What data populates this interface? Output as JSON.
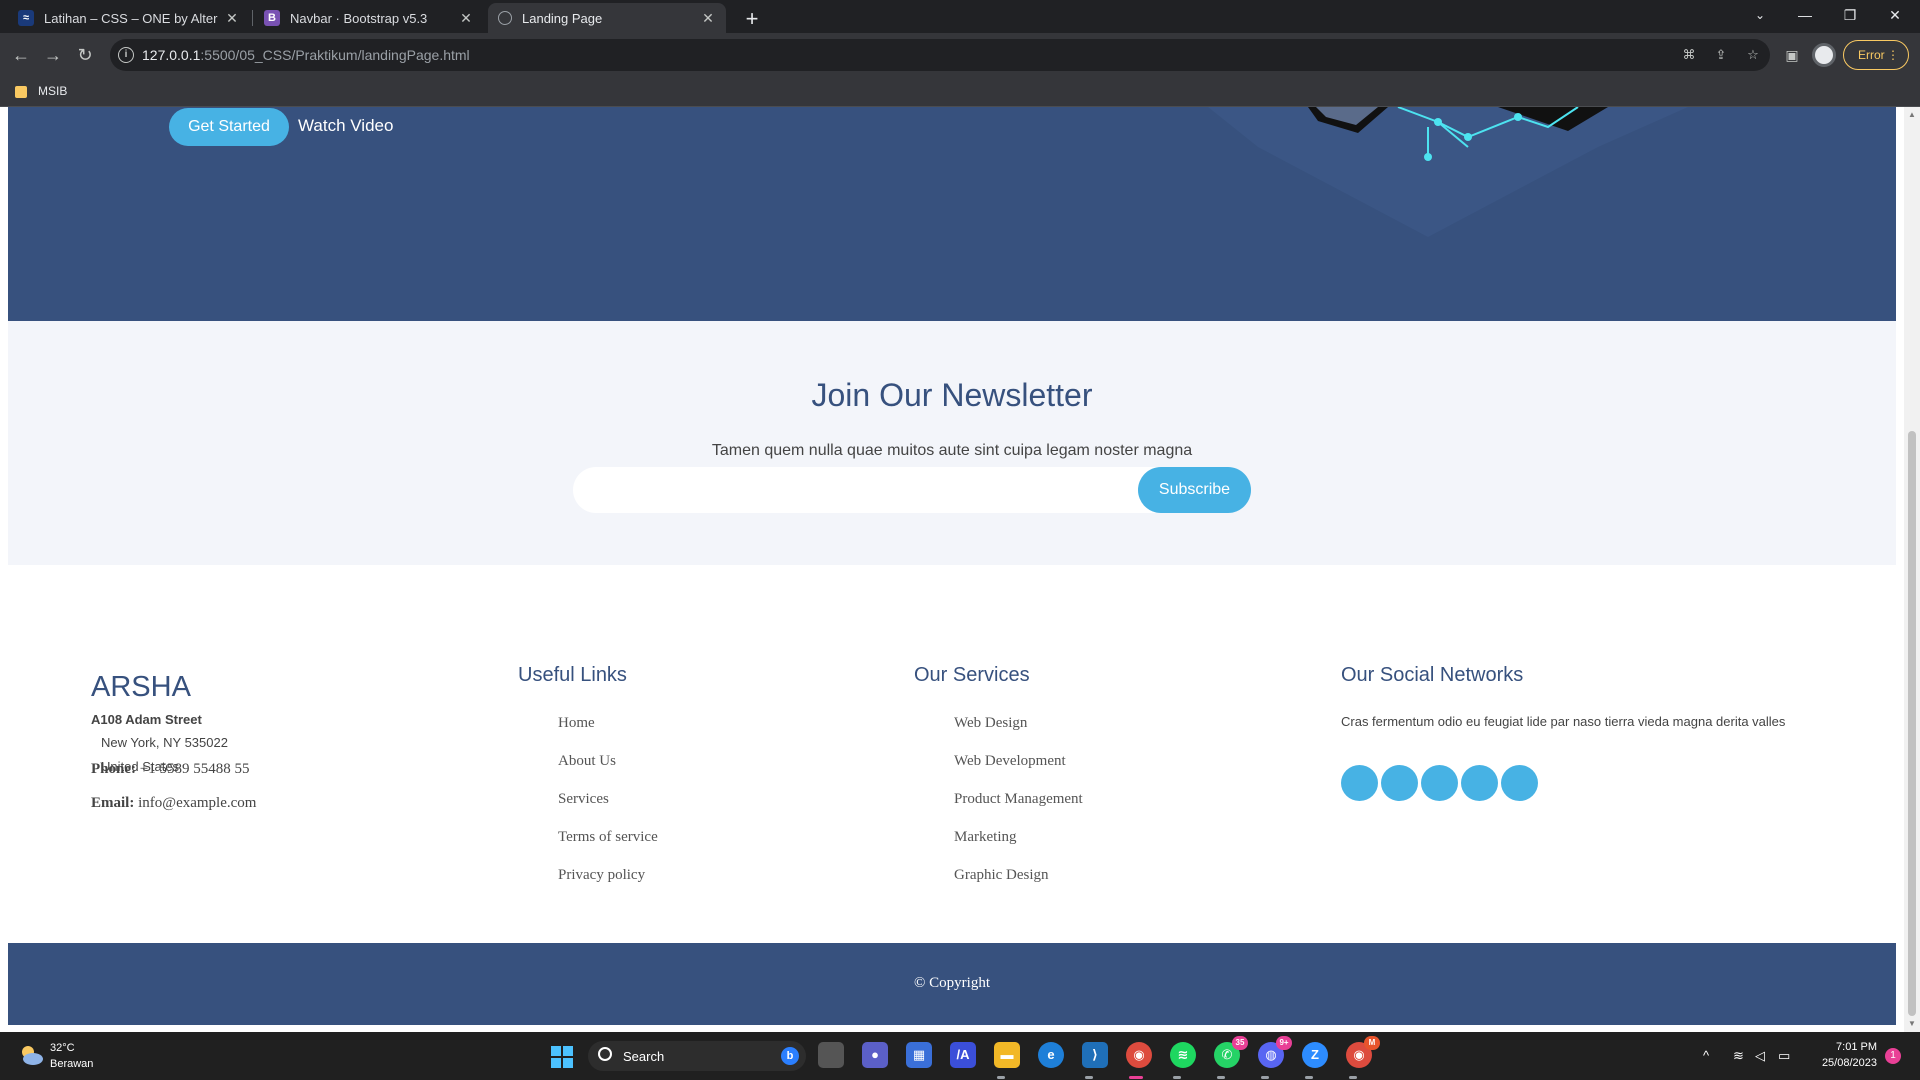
{
  "browser": {
    "tabs": [
      {
        "title": "Latihan – CSS – ONE by Alterra A",
        "active": false
      },
      {
        "title": "Navbar · Bootstrap v5.3",
        "active": false
      },
      {
        "title": "Landing Page",
        "active": true
      }
    ],
    "url_host": "127.0.0.1",
    "url_path": ":5500/05_CSS/Praktikum/landingPage.html",
    "error_label": "Error",
    "bookmark_folder": "MSIB"
  },
  "hero": {
    "get_started": "Get Started",
    "watch_video": "Watch Video"
  },
  "newsletter": {
    "title": "Join Our Newsletter",
    "subtitle": "Tamen quem nulla quae muitos aute sint cuipa legam noster magna",
    "input_value": "",
    "subscribe": "Subscribe"
  },
  "footer": {
    "brand": "ARSHA",
    "address_line1": "A108 Adam Street",
    "address_line2": "New York, NY 535022",
    "address_line3": "United States",
    "phone_label": "Phone:",
    "phone_value": "+1 5589 55488 55",
    "email_label": "Email:",
    "email_value": "info@example.com",
    "useful_links_title": "Useful Links",
    "useful_links": [
      "Home",
      "About Us",
      "Services",
      "Terms of service",
      "Privacy policy"
    ],
    "services_title": "Our Services",
    "services": [
      "Web Design",
      "Web Development",
      "Product Management",
      "Marketing",
      "Graphic Design"
    ],
    "social_title": "Our Social Networks",
    "social_text": "Cras fermentum odio eu feugiat lide par naso tierra vieda magna derita valles",
    "social_count": 5,
    "copyright": "© Copyright"
  },
  "taskbar": {
    "weather_temp": "32°C",
    "weather_desc": "Berawan",
    "search_label": "Search",
    "whatsapp_badge": "35",
    "discord_badge": "9+",
    "chrome2_badge": "M",
    "time": "7:01 PM",
    "date": "25/08/2023",
    "notifications": "1"
  },
  "colors": {
    "primary": "#37517e",
    "accent": "#47b2e4",
    "newsletter_bg": "#f3f5fa"
  }
}
